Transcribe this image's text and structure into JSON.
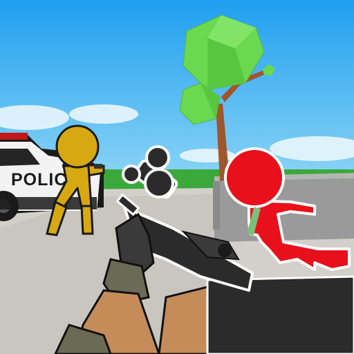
{
  "game": {
    "police_car_label": "POLICE"
  },
  "colors": {
    "sky_top": "#1f9ff0",
    "sky_bottom": "#7fd0f5",
    "grass": "#3aa83a",
    "ground": "#d3d0cb",
    "wall": "#9a9a9a",
    "enemy_red": "#e8101a",
    "enemy_yellow": "#d7a812",
    "tree_leaves": "#6ad94f",
    "tree_trunk": "#a0562c",
    "gun_metal": "#2b2b2b",
    "glove": "#3a3a3a",
    "skin": "#c58c5a",
    "camo": "#6b6a55"
  },
  "icons": {
    "crosshair": "none",
    "weapon": "sniper-rifle-icon"
  }
}
